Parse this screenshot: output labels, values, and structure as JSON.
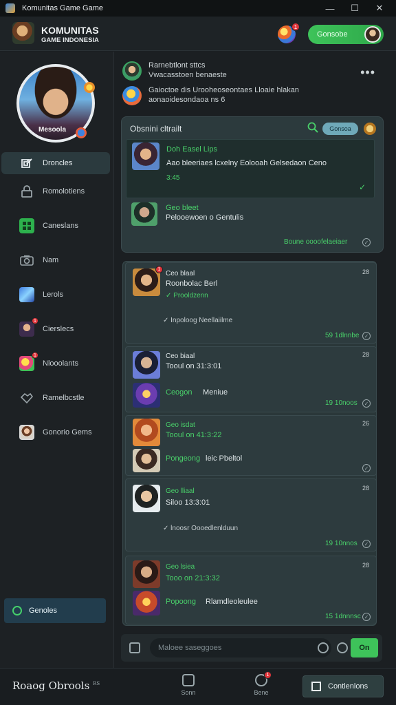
{
  "window": {
    "title": "Komunitas Game Game",
    "controls": [
      "—",
      "☐",
      "✕"
    ]
  },
  "header": {
    "brand_line1": "KOMUNITAS",
    "brand_line2": "GAME INDONESIA",
    "notif_count": "1",
    "action_button": "Gonsobe"
  },
  "sidebar": {
    "profile_name": "Mesoola",
    "items": [
      {
        "label": "Droncles",
        "icon": "pen-icon",
        "active": true
      },
      {
        "label": "Romolotiens",
        "icon": "lock-icon"
      },
      {
        "label": "Caneslans",
        "icon": "grid-icon"
      },
      {
        "label": "Nam",
        "icon": "camera-icon"
      },
      {
        "label": "Lerols",
        "icon": "game-icon"
      },
      {
        "label": "Cierslecs",
        "icon": "character-icon",
        "badge": "1"
      },
      {
        "label": "Nlooolants",
        "icon": "fruit-icon",
        "badge": "1"
      },
      {
        "label": "Ramelbcstle",
        "icon": "handshake-icon"
      },
      {
        "label": "Gonorio Gems",
        "icon": "avatar-icon"
      }
    ],
    "bottom_button": "Genoles"
  },
  "post": {
    "line1": "Rarnebtlont sttcs",
    "line2": "Vwacasstoen benaeste",
    "more": "•••",
    "line3": "Gaioctoe dis Urooheoseontaes Lloaie hlakan",
    "line4": "aonaoidesondaoa ns 6"
  },
  "panel1": {
    "title": "Obsnini cltrailt",
    "pill": "Gonsoa",
    "chat1_name": "Doh Easel Lips",
    "chat1_text": "Aao bleeriaes lcxelny Eolooah Gelsedaon Ceno",
    "chat1_time": "3:45",
    "chat2_name": "Geo bleet",
    "chat2_text": "Pelooewoen o Gentulis",
    "footer_link": "Boune oooofelaeiaer"
  },
  "messages": [
    {
      "name": "Ceo blaal",
      "title": "Roonbolac Berl",
      "sub": "✓ Prooldzenn",
      "line": "✓ Inpoloog Neellaiilme",
      "time": "28",
      "foot": "59 1dlnnbe"
    },
    {
      "name": "Ceo biaal",
      "title": "Tooul on 31:3:01",
      "line": "Ceogon",
      "extra": "Meniue",
      "time": "28",
      "foot": "19 10noos"
    },
    {
      "name": "Geo isdat",
      "title": "Tooul on 41:3:22",
      "line": "Pongeong",
      "extra": "leic Pbeltol",
      "time": "26",
      "foot": ""
    },
    {
      "name": "Geo lliaal",
      "title": "Siloo 13:3:01",
      "line": "✓ lnoosr Oooedlenlduun",
      "time": "28",
      "foot": "19 10nnos"
    },
    {
      "name": "Geo lsiea",
      "title": "Tooo on 21:3:32",
      "line": "Popoong",
      "extra": "Rlamdleoleulee",
      "time": "28",
      "foot": "15 1dnnnsc"
    }
  ],
  "composer": {
    "placeholder": "Maloee saseggoes",
    "send": "On"
  },
  "bottombar": {
    "left_label": "Roaog Obrools",
    "left_sup": "RS",
    "item1": "Sonn",
    "item2": "Bene",
    "item2_badge": "1",
    "button": "Contlenlons"
  }
}
